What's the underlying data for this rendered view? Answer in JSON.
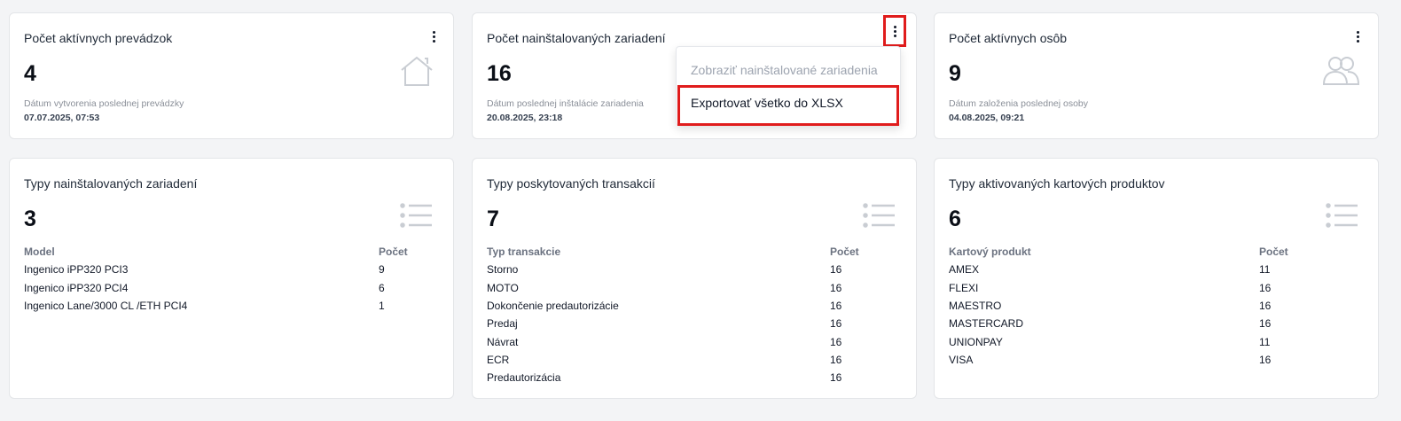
{
  "cards": {
    "active_stores": {
      "title": "Počet aktívnych prevádzok",
      "value": "4",
      "foot_label": "Dátum vytvorenia poslednej prevádzky",
      "foot_value": "07.07.2025, 07:53",
      "icon": "house-icon"
    },
    "installed_devices": {
      "title": "Počet nainštalovaných zariadení",
      "value": "16",
      "foot_label": "Dátum poslednej inštalácie zariadenia",
      "foot_value": "20.08.2025, 23:18"
    },
    "active_persons": {
      "title": "Počet aktívnych osôb",
      "value": "9",
      "foot_label": "Dátum založenia poslednej osoby",
      "foot_value": "04.08.2025, 09:21",
      "icon": "users-icon"
    },
    "device_types": {
      "title": "Typy nainštalovaných zariadení",
      "value": "3",
      "icon": "list-icon",
      "columns": [
        "Model",
        "Počet"
      ],
      "rows": [
        [
          "Ingenico iPP320 PCI3",
          "9"
        ],
        [
          "Ingenico iPP320 PCI4",
          "6"
        ],
        [
          "Ingenico Lane/3000 CL /ETH PCI4",
          "1"
        ]
      ]
    },
    "transaction_types": {
      "title": "Typy poskytovaných transakcií",
      "value": "7",
      "icon": "list-icon",
      "columns": [
        "Typ transakcie",
        "Počet"
      ],
      "rows": [
        [
          "Storno",
          "16"
        ],
        [
          "MOTO",
          "16"
        ],
        [
          "Dokončenie predautorizácie",
          "16"
        ],
        [
          "Predaj",
          "16"
        ],
        [
          "Návrat",
          "16"
        ],
        [
          "ECR",
          "16"
        ],
        [
          "Predautorizácia",
          "16"
        ]
      ]
    },
    "card_products": {
      "title": "Typy aktivovaných kartových produktov",
      "value": "6",
      "icon": "list-icon",
      "columns": [
        "Kartový produkt",
        "Počet"
      ],
      "rows": [
        [
          "AMEX",
          "11"
        ],
        [
          "FLEXI",
          "16"
        ],
        [
          "MAESTRO",
          "16"
        ],
        [
          "MASTERCARD",
          "16"
        ],
        [
          "UNIONPAY",
          "11"
        ],
        [
          "VISA",
          "16"
        ]
      ]
    }
  },
  "dropdown": {
    "items": [
      {
        "label": "Zobraziť nainštalované zariadenia",
        "disabled": true
      },
      {
        "label": "Exportovať všetko do XLSX",
        "disabled": false
      }
    ]
  },
  "colors": {
    "highlight": "#e01c1c",
    "icon_gray": "#c9cdd3",
    "background": "#f3f4f6"
  }
}
